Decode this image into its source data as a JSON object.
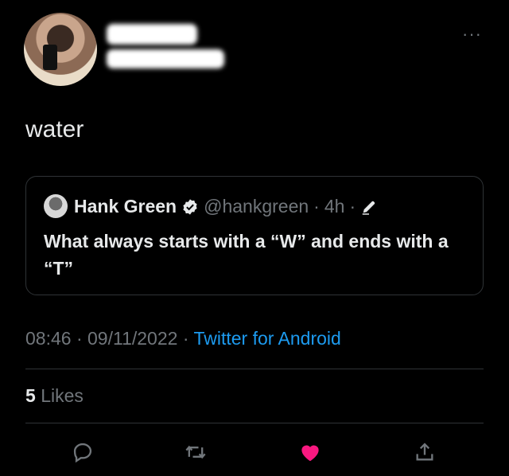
{
  "tweet": {
    "text": "water",
    "more_label": "···"
  },
  "quoted": {
    "name": "Hank Green",
    "handle": "@hankgreen",
    "separator": "·",
    "age": "4h",
    "body": "What always starts with a “W” and ends with a “T”"
  },
  "meta": {
    "time": "08:46",
    "dot": "·",
    "date": "09/11/2022",
    "source": "Twitter for Android"
  },
  "stats": {
    "likes_count": "5",
    "likes_label": "Likes"
  },
  "colors": {
    "accent": "#1d9bf0",
    "like": "#f91880",
    "muted": "#71767b"
  },
  "icons": [
    "reply-icon",
    "retweet-icon",
    "like-icon",
    "share-icon",
    "verified-icon",
    "edit-icon",
    "more-icon"
  ]
}
